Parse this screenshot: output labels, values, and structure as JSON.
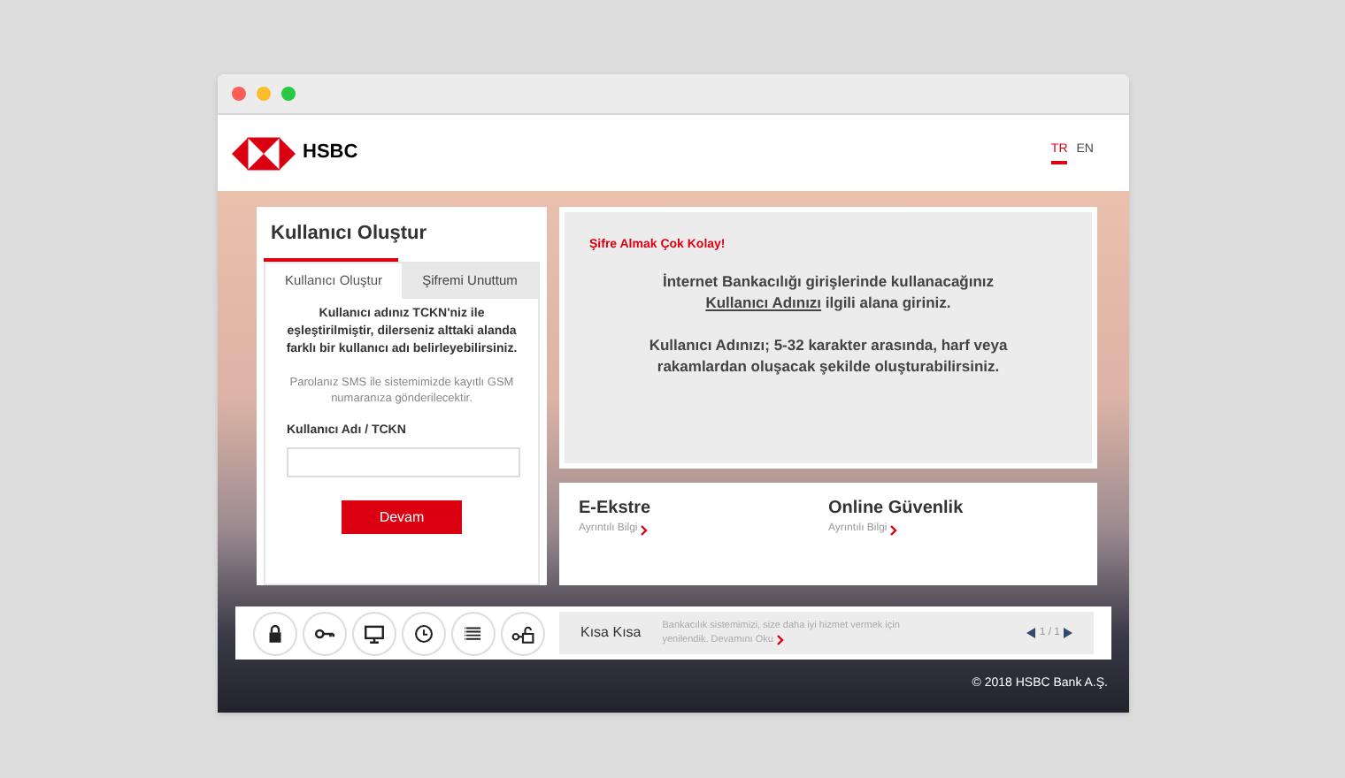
{
  "header": {
    "logo_text": "HSBC",
    "languages": [
      {
        "label": "TR",
        "selected": true
      },
      {
        "label": "EN",
        "selected": false
      }
    ]
  },
  "login_card": {
    "title": "Kullanıcı Oluştur",
    "tabs": [
      {
        "label": "Kullanıcı Oluştur",
        "selected": true
      },
      {
        "label": "Şifremi Unuttum",
        "selected": false
      }
    ],
    "intro": "Kullanıcı adınız TCKN'niz ile eşleştirilmiştir, dilerseniz alttaki alanda farklı bir kullanıcı adı belirleyebilirsiniz.",
    "note": "Parolanız SMS ile sistemimizde kayıtlı GSM numaranıza gönderilecektir.",
    "field_label": "Kullanıcı Adı / TCKN",
    "submit": "Devam"
  },
  "info_panel": {
    "heading": "Şifre Almak Çok Kolay!",
    "paragraph_1": {
      "before": "İnternet Bankacılığı girişlerinde kullanacağınız",
      "link": "Kullanıcı Adınızı",
      "after": "ilgili alana giriniz."
    },
    "paragraph_2": "Kullanıcı Adınızı; 5-32 karakter arasında, harf veya rakamlardan oluşacak şekilde oluşturabilirsiniz."
  },
  "promo_links": [
    {
      "title": "E-Ekstre",
      "link": "Ayrıntılı Bilgi"
    },
    {
      "title": "Online Güvenlik",
      "link": "Ayrıntılı Bilgi"
    }
  ],
  "quick_bar": {
    "buttons": [
      {
        "kind": "lock"
      },
      {
        "kind": "key"
      },
      {
        "kind": "monitor"
      },
      {
        "kind": "clock"
      },
      {
        "kind": "list"
      },
      {
        "kind": "keylock"
      }
    ],
    "news_title": "Kısa Kısa",
    "news_text": "Bankacılık sistemimizi, size daha iyi hizmet vermek için yenilendik.",
    "news_link": "Devamını Oku",
    "pager": "1 / 1"
  },
  "footer": "© 2018 HSBC Bank A.Ş."
}
